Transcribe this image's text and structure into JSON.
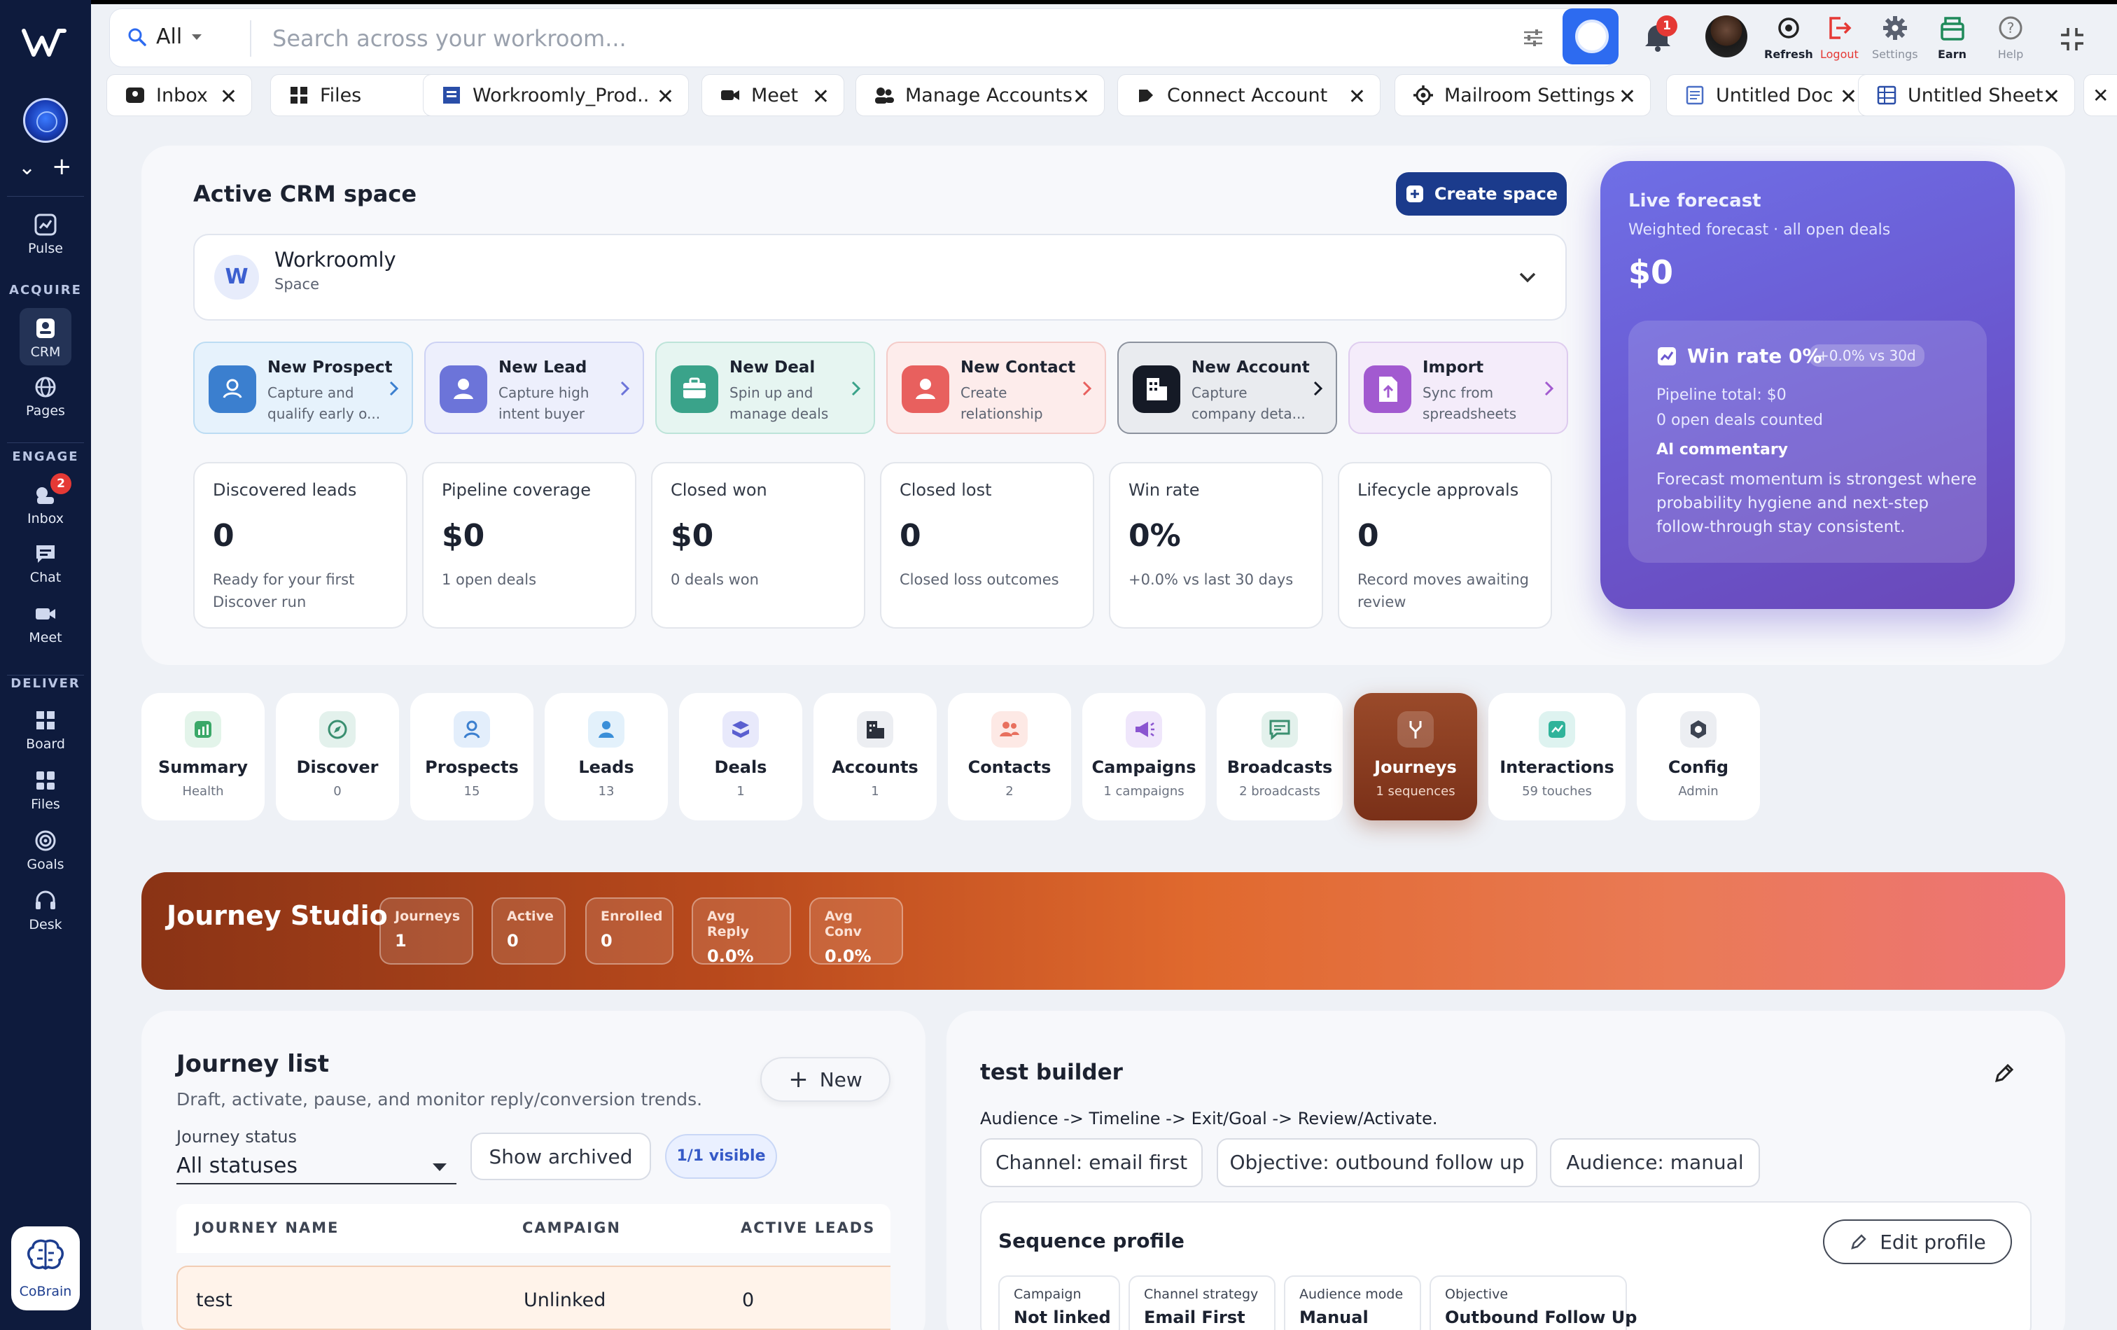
{
  "sidebar": {
    "items": [
      {
        "label": "Pulse"
      },
      {
        "label": "CRM"
      },
      {
        "label": "Pages"
      },
      {
        "label": "Inbox",
        "badge": "2"
      },
      {
        "label": "Chat"
      },
      {
        "label": "Meet"
      },
      {
        "label": "Board"
      },
      {
        "label": "Files"
      },
      {
        "label": "Goals"
      },
      {
        "label": "Desk"
      }
    ],
    "sections": {
      "acquire": "ACQUIRE",
      "engage": "ENGAGE",
      "deliver": "DELIVER"
    },
    "cobrain_label": "CoBrain"
  },
  "search": {
    "scope": "All",
    "placeholder": "Search across your workroom..."
  },
  "topbar": {
    "notifications_count": "1",
    "refresh_label": "Refresh",
    "logout_label": "Logout",
    "settings_label": "Settings",
    "earn_label": "Earn",
    "help_label": "Help"
  },
  "tabs": [
    {
      "label": "Inbox"
    },
    {
      "label": "Files"
    },
    {
      "label": "Workroomly_Prod..."
    },
    {
      "label": "Meet"
    },
    {
      "label": "Manage Accounts"
    },
    {
      "label": "Connect Account"
    },
    {
      "label": "Mailroom Settings"
    },
    {
      "label": "Untitled Doc"
    },
    {
      "label": "Untitled Sheet"
    }
  ],
  "crm": {
    "title": "Active CRM space",
    "create_label": "Create space",
    "space": {
      "initial": "W",
      "name": "Workroomly",
      "type": "Space"
    },
    "quick_actions": [
      {
        "title": "New Prospect",
        "desc": "Capture and qualify early o..."
      },
      {
        "title": "New Lead",
        "desc": "Capture high intent buyer"
      },
      {
        "title": "New Deal",
        "desc": "Spin up and manage deals"
      },
      {
        "title": "New Contact",
        "desc": "Create relationship"
      },
      {
        "title": "New Account",
        "desc": "Capture company deta..."
      },
      {
        "title": "Import",
        "desc": "Sync from spreadsheets"
      }
    ],
    "stats": [
      {
        "title": "Discovered leads",
        "value": "0",
        "desc": "Ready for your first Discover run"
      },
      {
        "title": "Pipeline coverage",
        "value": "$0",
        "desc": "1 open deals"
      },
      {
        "title": "Closed won",
        "value": "$0",
        "desc": "0 deals won"
      },
      {
        "title": "Closed lost",
        "value": "0",
        "desc": "Closed loss outcomes"
      },
      {
        "title": "Win rate",
        "value": "0%",
        "desc": "+0.0% vs last 30 days"
      },
      {
        "title": "Lifecycle approvals",
        "value": "0",
        "desc": "Record moves awaiting review"
      }
    ]
  },
  "forecast": {
    "title": "Live forecast",
    "subtitle": "Weighted forecast · all open deals",
    "value": "$0",
    "win_rate": "Win rate 0%",
    "win_delta": "+0.0% vs 30d",
    "pipeline_total": "Pipeline total: $0",
    "open_deals": "0 open deals counted",
    "ai_title": "AI commentary",
    "ai_text": "Forecast momentum is strongest where probability hygiene and next-step follow-through stay consistent."
  },
  "modules": [
    {
      "title": "Summary",
      "sub": "Health"
    },
    {
      "title": "Discover",
      "sub": "0"
    },
    {
      "title": "Prospects",
      "sub": "15"
    },
    {
      "title": "Leads",
      "sub": "13"
    },
    {
      "title": "Deals",
      "sub": "1"
    },
    {
      "title": "Accounts",
      "sub": "1"
    },
    {
      "title": "Contacts",
      "sub": "2"
    },
    {
      "title": "Campaigns",
      "sub": "1 campaigns"
    },
    {
      "title": "Broadcasts",
      "sub": "2 broadcasts"
    },
    {
      "title": "Journeys",
      "sub": "1 sequences"
    },
    {
      "title": "Interactions",
      "sub": "59 touches"
    },
    {
      "title": "Config",
      "sub": "Admin"
    }
  ],
  "studio": {
    "title": "Journey Studio",
    "chips": [
      {
        "label": "Journeys",
        "value": "1"
      },
      {
        "label": "Active",
        "value": "0"
      },
      {
        "label": "Enrolled",
        "value": "0"
      },
      {
        "label": "Avg Reply",
        "value": "0.0%"
      },
      {
        "label": "Avg Conv",
        "value": "0.0%"
      }
    ]
  },
  "journey_list": {
    "title": "Journey list",
    "subtitle": "Draft, activate, pause, and monitor reply/conversion trends.",
    "new_label": "New",
    "status_label": "Journey status",
    "status_value": "All statuses",
    "archived_label": "Show archived",
    "visible_label": "1/1 visible",
    "columns": [
      "JOURNEY NAME",
      "CAMPAIGN",
      "ACTIVE LEADS"
    ],
    "rows": [
      {
        "name": "test",
        "campaign": "Unlinked",
        "active_leads": "0"
      }
    ]
  },
  "builder": {
    "title": "test builder",
    "subtitle": "Audience -> Timeline -> Exit/Goal -> Review/Activate.",
    "chips": [
      "Channel: email first",
      "Objective: outbound follow up",
      "Audience: manual"
    ],
    "profile_title": "Sequence profile",
    "edit_profile_label": "Edit profile",
    "profile_items": [
      {
        "label": "Campaign",
        "value": "Not linked"
      },
      {
        "label": "Channel strategy",
        "value": "Email First"
      },
      {
        "label": "Audience mode",
        "value": "Manual"
      },
      {
        "label": "Objective",
        "value": "Outbound Follow Up"
      }
    ]
  },
  "colors": {
    "sidebar_bg": "#0e1b3d",
    "primary": "#1b3b8c",
    "search_button": "#2d6bf0",
    "forecast_gradient": "#6a57cf",
    "journeys_active": "#8a3a1e",
    "danger": "#e53935"
  }
}
